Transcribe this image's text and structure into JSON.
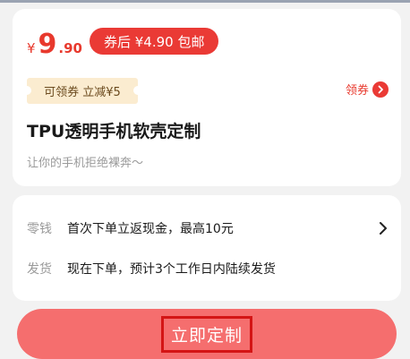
{
  "price": {
    "currency": "¥",
    "integer": "9",
    "decimal": ".90",
    "badge": "券后 ¥4.90 包邮"
  },
  "coupon": {
    "tag": "可领券 立减¥5",
    "action_label": "领券"
  },
  "product": {
    "title": "TPU透明手机软壳定制",
    "subtitle": "让你的手机拒绝裸奔～"
  },
  "info": {
    "cash_label": "零钱",
    "cash_value": "首次下单立返现金，最高10元",
    "ship_label": "发货",
    "ship_value": "现在下单，预计3个工作日内陆续发货"
  },
  "cta": {
    "label": "立即定制"
  },
  "colors": {
    "accent": "#ea3a35",
    "cta": "#f56e6e",
    "coupon_bg": "#fbecd0",
    "highlight_box": "#d41515"
  },
  "icons": [
    "chevron-right-icon",
    "arrow-right-circle-icon"
  ]
}
